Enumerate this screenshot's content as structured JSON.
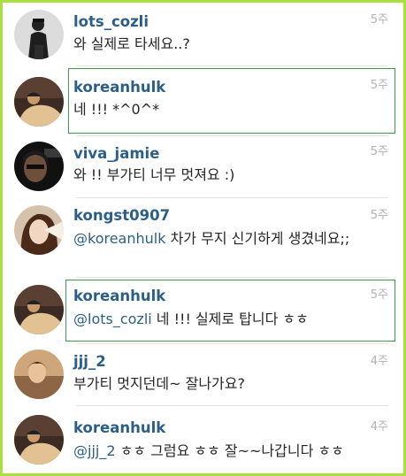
{
  "comments": [
    {
      "username": "lots_cozli",
      "time": "5주",
      "text": "와 실제로 타세요..?"
    },
    {
      "username": "koreanhulk",
      "time": "5주",
      "text": "네 !!! *^0^*"
    },
    {
      "username": "viva_jamie",
      "time": "5주",
      "text": "와 !! 부가티 너무 멋져요 :)"
    },
    {
      "username": "kongst0907",
      "time": "5주",
      "mention": "@koreanhulk",
      "text": "  차가 무지 신기하게 생겼네요;;"
    },
    {
      "username": "koreanhulk",
      "time": "5주",
      "mention": "@lots_cozli",
      "text": " 네 !!! 실제로 탑니다 ㅎㅎ"
    },
    {
      "username": "jjj_2",
      "time": "4주",
      "text": "부가티 멋지던데~ 잘나가요?"
    },
    {
      "username": "koreanhulk",
      "time": "4주",
      "mention": "@jjj_2",
      "text": " ㅎㅎ 그럼요 ㅎㅎ 잘~~나갑니다 ㅎㅎ"
    }
  ],
  "avatars": [
    {
      "icon": "avatar-photo-man-cap",
      "colors": [
        "#e9e9e9",
        "#2a2a2a"
      ]
    },
    {
      "icon": "avatar-photo-koreanhulk",
      "colors": [
        "#3a2a22",
        "#e0bf8d"
      ]
    },
    {
      "icon": "avatar-photo-viva-jamie",
      "colors": [
        "#0f0f0f",
        "#6b4c3a"
      ]
    },
    {
      "icon": "avatar-photo-kongst",
      "colors": [
        "#d8c6b4",
        "#3b2416"
      ]
    },
    {
      "icon": "avatar-photo-jjj2",
      "colors": [
        "#caa37a",
        "#5a3a24"
      ]
    }
  ]
}
